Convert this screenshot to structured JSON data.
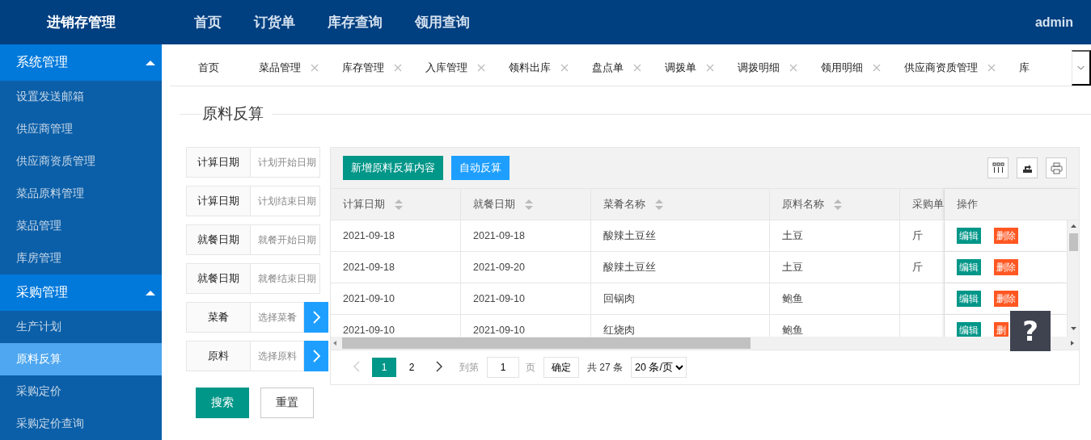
{
  "header": {
    "logo": "进销存管理",
    "nav": [
      "首页",
      "订货单",
      "库存查询",
      "领用查询"
    ],
    "user": "admin"
  },
  "sidebar": {
    "groups": [
      {
        "label": "系统管理",
        "expanded": true,
        "items": [
          {
            "label": "设置发送邮箱",
            "selected": false
          },
          {
            "label": "供应商管理",
            "selected": false
          },
          {
            "label": "供应商资质管理",
            "selected": false
          },
          {
            "label": "菜品原料管理",
            "selected": false
          },
          {
            "label": "菜品管理",
            "selected": false
          },
          {
            "label": "库房管理",
            "selected": false
          }
        ]
      },
      {
        "label": "采购管理",
        "expanded": true,
        "items": [
          {
            "label": "生产计划",
            "selected": false
          },
          {
            "label": "原料反算",
            "selected": true
          },
          {
            "label": "采购定价",
            "selected": false
          },
          {
            "label": "采购定价查询",
            "selected": false
          }
        ]
      }
    ]
  },
  "tabs": [
    {
      "label": "首页",
      "closable": false,
      "selected": false
    },
    {
      "label": "菜品管理",
      "closable": true,
      "selected": false
    },
    {
      "label": "库存管理",
      "closable": true,
      "selected": false
    },
    {
      "label": "入库管理",
      "closable": true,
      "selected": false
    },
    {
      "label": "领料出库",
      "closable": true,
      "selected": false
    },
    {
      "label": "盘点单",
      "closable": true,
      "selected": false
    },
    {
      "label": "调拨单",
      "closable": true,
      "selected": false
    },
    {
      "label": "调拨明细",
      "closable": true,
      "selected": false
    },
    {
      "label": "领用明细",
      "closable": true,
      "selected": false
    },
    {
      "label": "供应商资质管理",
      "closable": true,
      "selected": false
    },
    {
      "label": "库",
      "closable": false,
      "selected": false
    }
  ],
  "page_title": "原料反算",
  "filters": [
    {
      "kind": "date",
      "label": "计算日期",
      "placeholder": "计划开始日期"
    },
    {
      "kind": "date",
      "label": "计算日期",
      "placeholder": "计划结束日期"
    },
    {
      "kind": "date",
      "label": "就餐日期",
      "placeholder": "就餐开始日期"
    },
    {
      "kind": "date",
      "label": "就餐日期",
      "placeholder": "就餐结束日期"
    },
    {
      "kind": "picker",
      "label": "菜肴",
      "placeholder": "选择菜肴"
    },
    {
      "kind": "picker",
      "label": "原料",
      "placeholder": "选择原料"
    }
  ],
  "form_buttons": [
    "搜索",
    "重置"
  ],
  "toolbar_buttons": [
    "新增原料反算内容",
    "自动反算"
  ],
  "table": {
    "columns": [
      {
        "label": "计算日期",
        "sortable": true
      },
      {
        "label": "就餐日期",
        "sortable": true
      },
      {
        "label": "菜肴名称",
        "sortable": true
      },
      {
        "label": "原料名称",
        "sortable": true
      },
      {
        "label": "采购单",
        "sortable": false
      }
    ],
    "action_column": "操作",
    "rows": [
      {
        "cells": [
          "2021-09-18",
          "2021-09-18",
          "酸辣土豆丝",
          "土豆",
          "斤"
        ],
        "actions": [
          "编辑",
          "删除"
        ]
      },
      {
        "cells": [
          "2021-09-18",
          "2021-09-20",
          "酸辣土豆丝",
          "土豆",
          "斤"
        ],
        "actions": [
          "编辑",
          "删除"
        ]
      },
      {
        "cells": [
          "2021-09-10",
          "2021-09-10",
          "回锅肉",
          "鲍鱼"
        ],
        "actions": [
          "编辑",
          "删除"
        ]
      },
      {
        "cells": [
          "2021-09-10",
          "2021-09-10",
          "红烧肉",
          "鲍鱼"
        ],
        "actions": [
          "编辑",
          "删"
        ]
      }
    ]
  },
  "pagination": {
    "pages": [
      {
        "label": "1",
        "selected": true
      },
      {
        "label": "2",
        "selected": false
      }
    ],
    "goto_label": "到第",
    "goto_value": "1",
    "page_unit": "页",
    "confirm": "确定",
    "total": "共 27 条",
    "page_size": "20 条/页"
  },
  "help_button": "?"
}
